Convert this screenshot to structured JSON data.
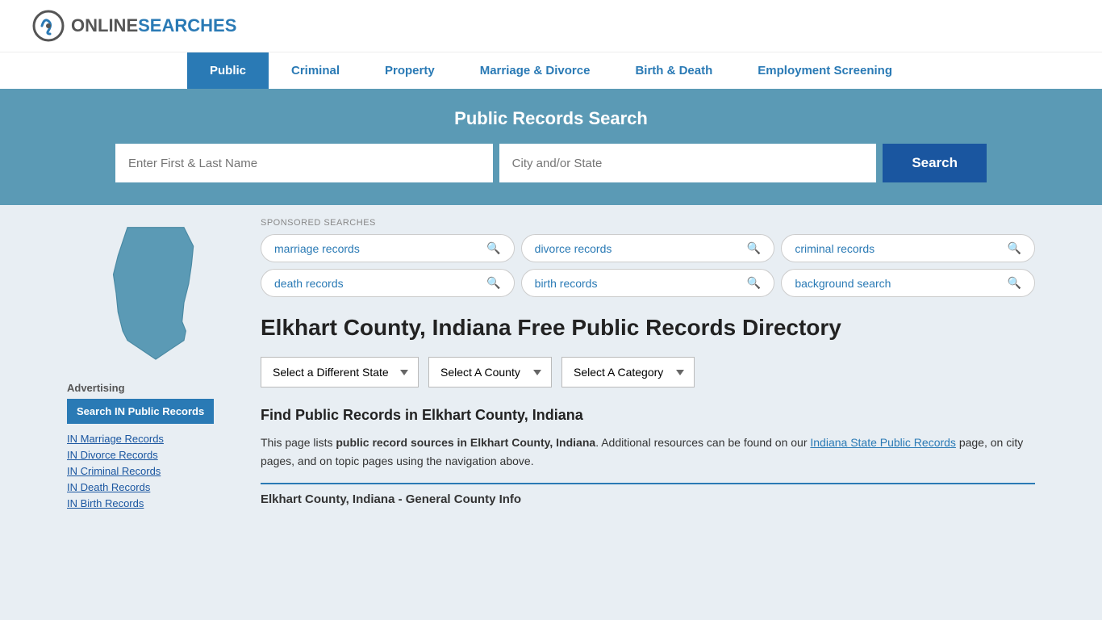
{
  "header": {
    "logo_online": "ONLINE",
    "logo_searches": "SEARCHES"
  },
  "nav": {
    "items": [
      {
        "label": "Public",
        "active": true
      },
      {
        "label": "Criminal",
        "active": false
      },
      {
        "label": "Property",
        "active": false
      },
      {
        "label": "Marriage & Divorce",
        "active": false
      },
      {
        "label": "Birth & Death",
        "active": false
      },
      {
        "label": "Employment Screening",
        "active": false
      }
    ]
  },
  "hero": {
    "title": "Public Records Search",
    "name_placeholder": "Enter First & Last Name",
    "location_placeholder": "City and/or State",
    "search_label": "Search"
  },
  "sponsored": {
    "label": "SPONSORED SEARCHES",
    "items": [
      {
        "text": "marriage records"
      },
      {
        "text": "divorce records"
      },
      {
        "text": "criminal records"
      },
      {
        "text": "death records"
      },
      {
        "text": "birth records"
      },
      {
        "text": "background search"
      }
    ]
  },
  "page": {
    "title": "Elkhart County, Indiana Free Public Records Directory",
    "dropdowns": {
      "state": "Select a Different State",
      "county": "Select A County",
      "category": "Select A Category"
    },
    "find_title": "Find Public Records in Elkhart County, Indiana",
    "find_description_1": "This page lists ",
    "find_description_bold": "public record sources in Elkhart County, Indiana",
    "find_description_2": ". Additional resources can be found on our ",
    "find_link_text": "Indiana State Public Records",
    "find_description_3": " page, on city pages, and on topic pages using the navigation above.",
    "county_info_header": "Elkhart County, Indiana - General County Info"
  },
  "sidebar": {
    "advertising_label": "Advertising",
    "cta_button": "Search IN Public Records",
    "links": [
      {
        "label": "IN Marriage Records"
      },
      {
        "label": "IN Divorce Records"
      },
      {
        "label": "IN Criminal Records"
      },
      {
        "label": "IN Death Records"
      },
      {
        "label": "IN Birth Records"
      }
    ]
  }
}
